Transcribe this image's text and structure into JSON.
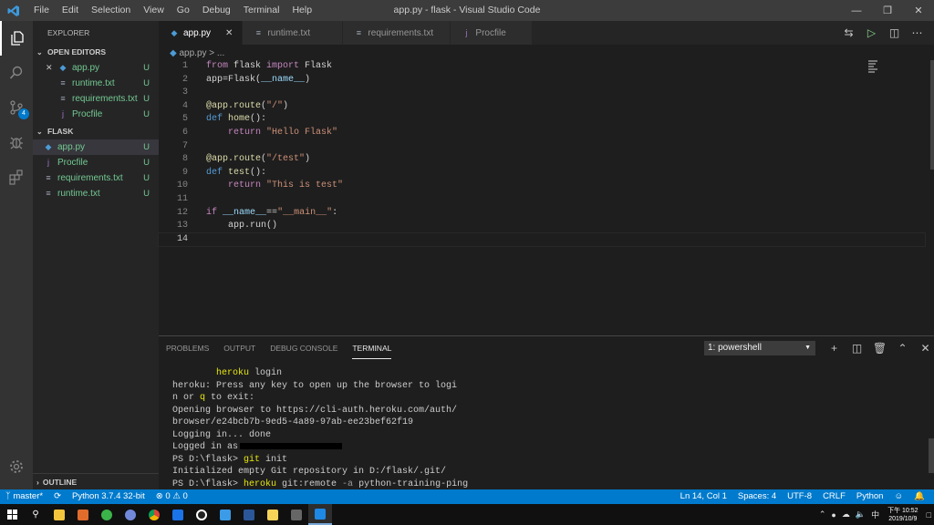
{
  "window": {
    "title": "app.py - flask - Visual Studio Code",
    "menu": [
      "File",
      "Edit",
      "Selection",
      "View",
      "Go",
      "Debug",
      "Terminal",
      "Help"
    ]
  },
  "activity": {
    "scm_badge": "4"
  },
  "explorer": {
    "title": "EXPLORER",
    "open_editors_label": "OPEN EDITORS",
    "open_editors": [
      {
        "name": "app.py",
        "status": "U"
      },
      {
        "name": "runtime.txt",
        "status": "U"
      },
      {
        "name": "requirements.txt",
        "status": "U"
      },
      {
        "name": "Procfile",
        "status": "U"
      }
    ],
    "folder_label": "FLASK",
    "files": [
      {
        "name": "app.py",
        "status": "U"
      },
      {
        "name": "Procfile",
        "status": "U"
      },
      {
        "name": "requirements.txt",
        "status": "U"
      },
      {
        "name": "runtime.txt",
        "status": "U"
      }
    ],
    "outline_label": "OUTLINE"
  },
  "tabs": [
    {
      "label": "app.py"
    },
    {
      "label": "runtime.txt"
    },
    {
      "label": "requirements.txt"
    },
    {
      "label": "Procfile"
    }
  ],
  "breadcrumb": "app.py > ...",
  "editor": {
    "line_numbers": [
      "1",
      "2",
      "3",
      "4",
      "5",
      "6",
      "7",
      "8",
      "9",
      "10",
      "11",
      "12",
      "13",
      "14"
    ]
  },
  "panel": {
    "tabs": [
      "PROBLEMS",
      "OUTPUT",
      "DEBUG CONSOLE",
      "TERMINAL"
    ],
    "terminal_select": "1: powershell"
  },
  "status": {
    "branch": "master*",
    "python": "Python 3.7.4 32-bit",
    "errors": "0",
    "warnings": "0",
    "position": "Ln 14, Col 1",
    "spaces": "Spaces: 4",
    "encoding": "UTF-8",
    "eol": "CRLF",
    "language": "Python"
  },
  "taskbar": {
    "time": "下午 10:52",
    "date": "2019/10/9"
  },
  "colors": {
    "accent": "#007acc",
    "untracked": "#73c991",
    "terminal_highlight": "#e5e510"
  }
}
